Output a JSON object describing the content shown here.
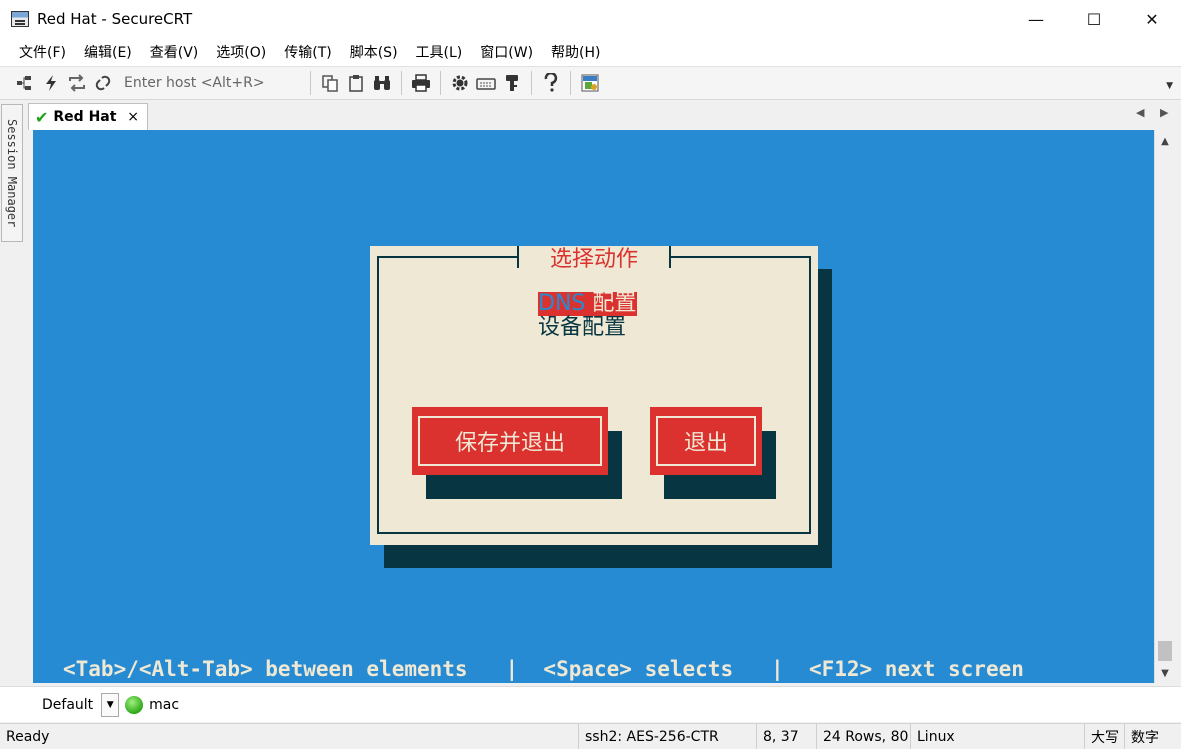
{
  "window": {
    "title": "Red Hat - SecureCRT",
    "minimize": "—",
    "maximize": "☐",
    "close": "✕"
  },
  "menu": [
    "文件(F)",
    "编辑(E)",
    "查看(V)",
    "选项(O)",
    "传输(T)",
    "脚本(S)",
    "工具(L)",
    "窗口(W)",
    "帮助(H)"
  ],
  "toolbar": {
    "host_placeholder": "Enter host <Alt+R>"
  },
  "session_manager": {
    "label": "Session Manager"
  },
  "tab": {
    "label": "Red Hat",
    "close": "×"
  },
  "dialog": {
    "title": "选择动作",
    "options": [
      {
        "highlight": "DNS",
        "rest": " 配置"
      },
      {
        "label": "设备配置"
      }
    ],
    "buttons": {
      "save_exit": "保存并退出",
      "exit": "退出"
    }
  },
  "hint_line": "<Tab>/<Alt-Tab> between elements   |  <Space> selects   |  <F12> next screen",
  "session_bar": {
    "default_label": "Default",
    "session_name": "mac"
  },
  "status": {
    "ready": "Ready",
    "cipher": "ssh2: AES-256-CTR",
    "position": "8, 37",
    "size": "24 Rows, 80",
    "term": "Linux",
    "caps": "大写",
    "num": "数字"
  },
  "colors": {
    "terminal_bg": "#268bd2",
    "dialog_bg": "#eee8d5",
    "accent_red": "#dc322f",
    "shadow": "#073642"
  }
}
